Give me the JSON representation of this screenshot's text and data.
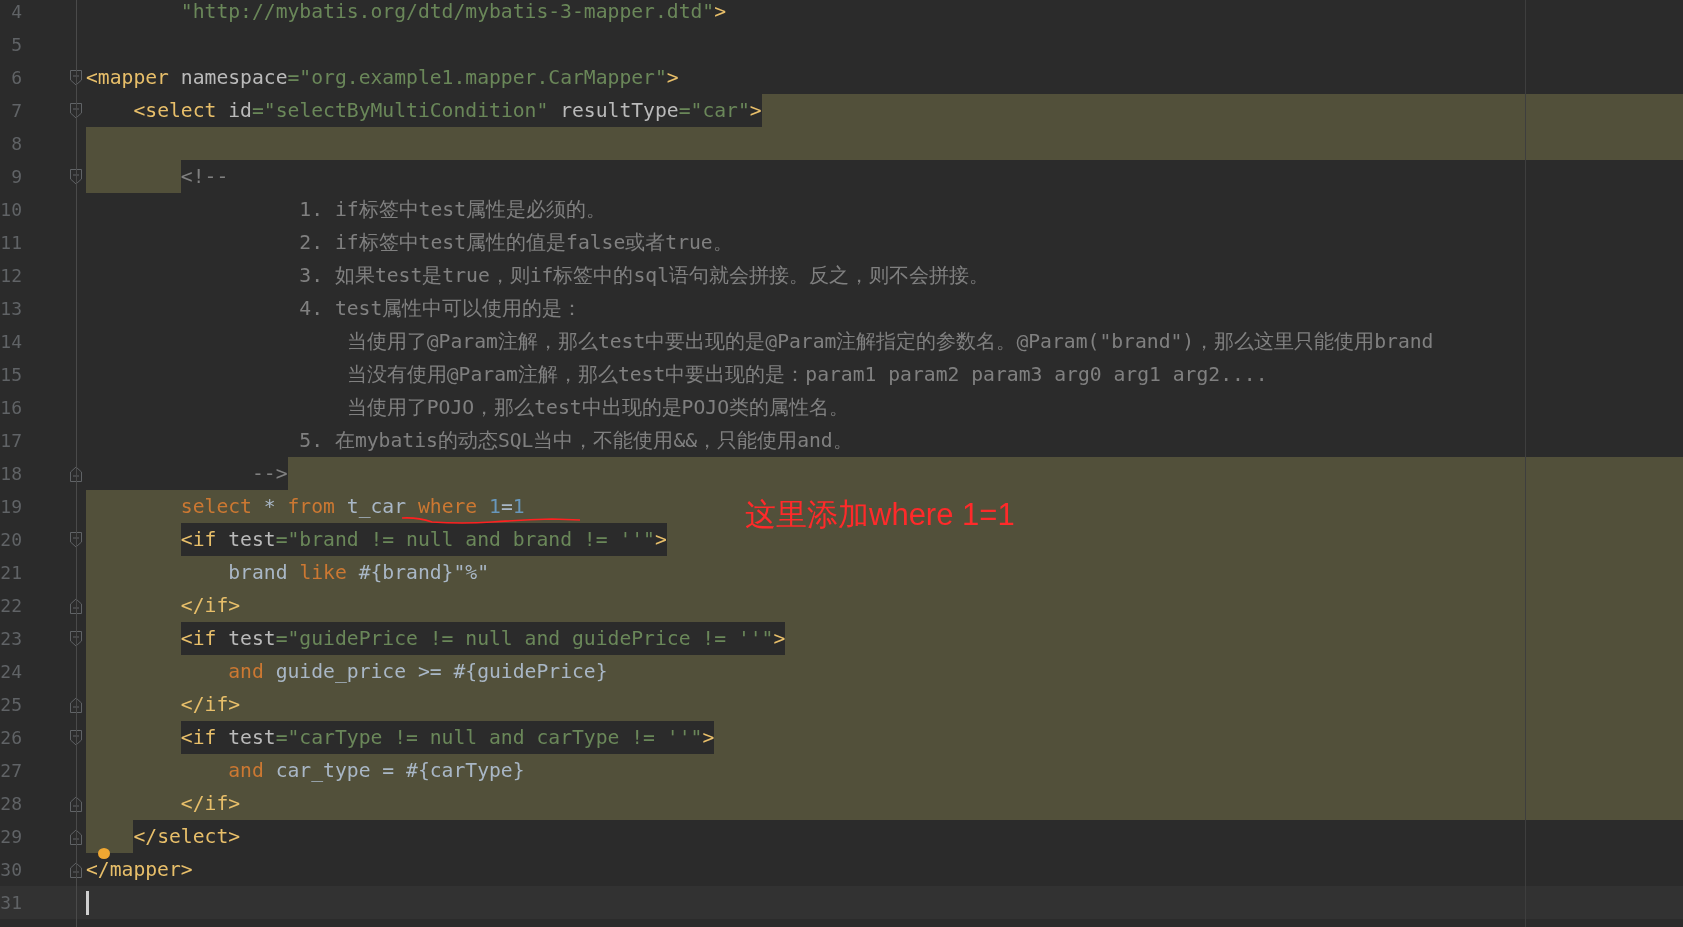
{
  "editor": {
    "lines": [
      {
        "number": "4",
        "fold_open": false,
        "fold_close": false,
        "band_before": false,
        "band_text": false,
        "band_after": false,
        "current": false,
        "bulb": false,
        "tokens": [
          {
            "kind": "value",
            "text": "        \"http://mybatis.org/dtd/mybatis-3-mapper.dtd\""
          },
          {
            "kind": "tag",
            "text": ">"
          }
        ]
      },
      {
        "number": "5",
        "fold_open": false,
        "fold_close": false,
        "band_after": false,
        "current": false,
        "bulb": false
      },
      {
        "number": "6",
        "fold_open": true,
        "fold_close": false,
        "band_text": false,
        "band_after": false,
        "current": false,
        "bulb": false,
        "tokens": [
          {
            "kind": "tag",
            "text": "<mapper"
          },
          {
            "kind": "attr",
            "text": " namespace"
          },
          {
            "kind": "value",
            "text": "=\"org.example1.mapper.CarMapper\""
          },
          {
            "kind": "tag",
            "text": ">"
          }
        ]
      },
      {
        "number": "7",
        "fold_open": true,
        "fold_close": false,
        "band_before": false,
        "band_text": false,
        "band_after": true,
        "current": false,
        "bulb": false,
        "tokens": [
          {
            "kind": "tag",
            "text": "    <select"
          },
          {
            "kind": "attr",
            "text": " id"
          },
          {
            "kind": "value",
            "text": "=\"selectByMultiCondition\""
          },
          {
            "kind": "attr",
            "text": " resultType"
          },
          {
            "kind": "value",
            "text": "=\"car\""
          },
          {
            "kind": "tag",
            "text": ">"
          }
        ]
      },
      {
        "number": "8",
        "fold_open": false,
        "fold_close": false,
        "band_after": true,
        "current": false,
        "bulb": false
      },
      {
        "number": "9",
        "fold_open": true,
        "fold_close": false,
        "band_before": true,
        "band_text": false,
        "band_after": false,
        "current": false,
        "bulb": false,
        "tokens": [
          {
            "kind": "comment",
            "text": "        <!--"
          }
        ]
      },
      {
        "number": "10",
        "fold_open": false,
        "fold_close": false,
        "band_before": false,
        "band_text": false,
        "band_after": false,
        "current": false,
        "bulb": false,
        "tokens": [
          {
            "kind": "comment",
            "text": "                  1. if标签中test属性是必须的。"
          }
        ]
      },
      {
        "number": "11",
        "fold_open": false,
        "fold_close": false,
        "band_before": false,
        "band_text": false,
        "band_after": false,
        "current": false,
        "bulb": false,
        "tokens": [
          {
            "kind": "comment",
            "text": "                  2. if标签中test属性的值是false或者true。"
          }
        ]
      },
      {
        "number": "12",
        "fold_open": false,
        "fold_close": false,
        "band_before": false,
        "band_text": false,
        "band_after": false,
        "current": false,
        "bulb": false,
        "tokens": [
          {
            "kind": "comment",
            "text": "                  3. 如果test是true，则if标签中的sql语句就会拼接。反之，则不会拼接。"
          }
        ]
      },
      {
        "number": "13",
        "fold_open": false,
        "fold_close": false,
        "band_before": false,
        "band_text": false,
        "band_after": false,
        "current": false,
        "bulb": false,
        "tokens": [
          {
            "kind": "comment",
            "text": "                  4. test属性中可以使用的是："
          }
        ]
      },
      {
        "number": "14",
        "fold_open": false,
        "fold_close": false,
        "band_before": false,
        "band_text": false,
        "band_after": false,
        "current": false,
        "bulb": false,
        "tokens": [
          {
            "kind": "comment",
            "text": "                      当使用了@Param注解，那么test中要出现的是@Param注解指定的参数名。@Param(\"brand\")，那么这里只能使用brand"
          }
        ]
      },
      {
        "number": "15",
        "fold_open": false,
        "fold_close": false,
        "band_before": false,
        "band_text": false,
        "band_after": false,
        "current": false,
        "bulb": false,
        "tokens": [
          {
            "kind": "comment",
            "text": "                      当没有使用@Param注解，那么test中要出现的是：param1 param2 param3 arg0 arg1 arg2...."
          }
        ]
      },
      {
        "number": "16",
        "fold_open": false,
        "fold_close": false,
        "band_before": false,
        "band_text": false,
        "band_after": false,
        "current": false,
        "bulb": false,
        "tokens": [
          {
            "kind": "comment",
            "text": "                      当使用了POJO，那么test中出现的是POJO类的属性名。"
          }
        ]
      },
      {
        "number": "17",
        "fold_open": false,
        "fold_close": false,
        "band_before": false,
        "band_text": false,
        "band_after": false,
        "current": false,
        "bulb": false,
        "tokens": [
          {
            "kind": "comment",
            "text": "                  5. 在mybatis的动态SQL当中，不能使用&&，只能使用and。"
          }
        ]
      },
      {
        "number": "18",
        "fold_open": false,
        "fold_close": true,
        "band_before": false,
        "band_text": false,
        "band_after": true,
        "current": false,
        "bulb": false,
        "tokens": [
          {
            "kind": "comment",
            "text": "              -->"
          }
        ]
      },
      {
        "number": "19",
        "fold_open": false,
        "fold_close": false,
        "band_before": true,
        "band_text": true,
        "band_after": true,
        "current": false,
        "bulb": false,
        "tokens": [
          {
            "kind": "keyword",
            "text": "        select"
          },
          {
            "kind": "text",
            "text": " * "
          },
          {
            "kind": "keyword",
            "text": "from"
          },
          {
            "kind": "text",
            "text": " t_car "
          },
          {
            "kind": "keyword",
            "text": "where"
          },
          {
            "kind": "number",
            "text": " 1"
          },
          {
            "kind": "text",
            "text": "="
          },
          {
            "kind": "number",
            "text": "1"
          }
        ]
      },
      {
        "number": "20",
        "fold_open": true,
        "fold_close": false,
        "band_before": true,
        "band_text": false,
        "band_after": true,
        "current": false,
        "bulb": false,
        "tokens": [
          {
            "kind": "tag",
            "text": "        <if"
          },
          {
            "kind": "attr",
            "text": " test"
          },
          {
            "kind": "value",
            "text": "=\"brand != null and brand != ''\""
          },
          {
            "kind": "tag",
            "text": ">"
          }
        ]
      },
      {
        "number": "21",
        "fold_open": false,
        "fold_close": false,
        "band_before": true,
        "band_text": true,
        "band_after": true,
        "current": false,
        "bulb": false,
        "tokens": [
          {
            "kind": "text",
            "text": "            brand "
          },
          {
            "kind": "keyword",
            "text": "like"
          },
          {
            "kind": "text",
            "text": " #{brand}\"%\""
          }
        ]
      },
      {
        "number": "22",
        "fold_open": false,
        "fold_close": true,
        "band_before": true,
        "band_text": true,
        "band_after": true,
        "current": false,
        "bulb": false,
        "tokens": [
          {
            "kind": "tag",
            "text": "        </if>"
          }
        ]
      },
      {
        "number": "23",
        "fold_open": true,
        "fold_close": false,
        "band_before": true,
        "band_text": false,
        "band_after": true,
        "current": false,
        "bulb": false,
        "tokens": [
          {
            "kind": "tag",
            "text": "        <if"
          },
          {
            "kind": "attr",
            "text": " test"
          },
          {
            "kind": "value",
            "text": "=\"guidePrice != null and guidePrice != ''\""
          },
          {
            "kind": "tag",
            "text": ">"
          }
        ]
      },
      {
        "number": "24",
        "fold_open": false,
        "fold_close": false,
        "band_before": true,
        "band_text": true,
        "band_after": true,
        "current": false,
        "bulb": false,
        "tokens": [
          {
            "kind": "keyword",
            "text": "            and"
          },
          {
            "kind": "text",
            "text": " guide_price >= #{guidePrice}"
          }
        ]
      },
      {
        "number": "25",
        "fold_open": false,
        "fold_close": true,
        "band_before": true,
        "band_text": true,
        "band_after": true,
        "current": false,
        "bulb": false,
        "tokens": [
          {
            "kind": "tag",
            "text": "        </if>"
          }
        ]
      },
      {
        "number": "26",
        "fold_open": true,
        "fold_close": false,
        "band_before": true,
        "band_text": false,
        "band_after": true,
        "current": false,
        "bulb": false,
        "tokens": [
          {
            "kind": "tag",
            "text": "        <if"
          },
          {
            "kind": "attr",
            "text": " test"
          },
          {
            "kind": "value",
            "text": "=\"carType != null and carType != ''\""
          },
          {
            "kind": "tag",
            "text": ">"
          }
        ]
      },
      {
        "number": "27",
        "fold_open": false,
        "fold_close": false,
        "band_before": true,
        "band_text": true,
        "band_after": true,
        "current": false,
        "bulb": false,
        "tokens": [
          {
            "kind": "keyword",
            "text": "            and"
          },
          {
            "kind": "text",
            "text": " car_type = #{carType}"
          }
        ]
      },
      {
        "number": "28",
        "fold_open": false,
        "fold_close": true,
        "band_before": true,
        "band_text": true,
        "band_after": true,
        "current": false,
        "bulb": false,
        "tokens": [
          {
            "kind": "tag",
            "text": "        </if>"
          }
        ]
      },
      {
        "number": "29",
        "fold_open": false,
        "fold_close": true,
        "band_before": true,
        "band_text": false,
        "band_after": false,
        "current": false,
        "bulb": false,
        "tokens": [
          {
            "kind": "tag",
            "text": "    </select>"
          }
        ]
      },
      {
        "number": "30",
        "fold_open": false,
        "fold_close": true,
        "band_text": false,
        "band_after": false,
        "current": false,
        "bulb": true,
        "tokens": [
          {
            "kind": "tag",
            "text": "</mapper>"
          }
        ]
      },
      {
        "number": "31",
        "fold_open": false,
        "fold_close": false,
        "band_after": false,
        "current": true,
        "bulb": false
      }
    ],
    "annotation": {
      "text": "这里添加where 1=1"
    }
  }
}
